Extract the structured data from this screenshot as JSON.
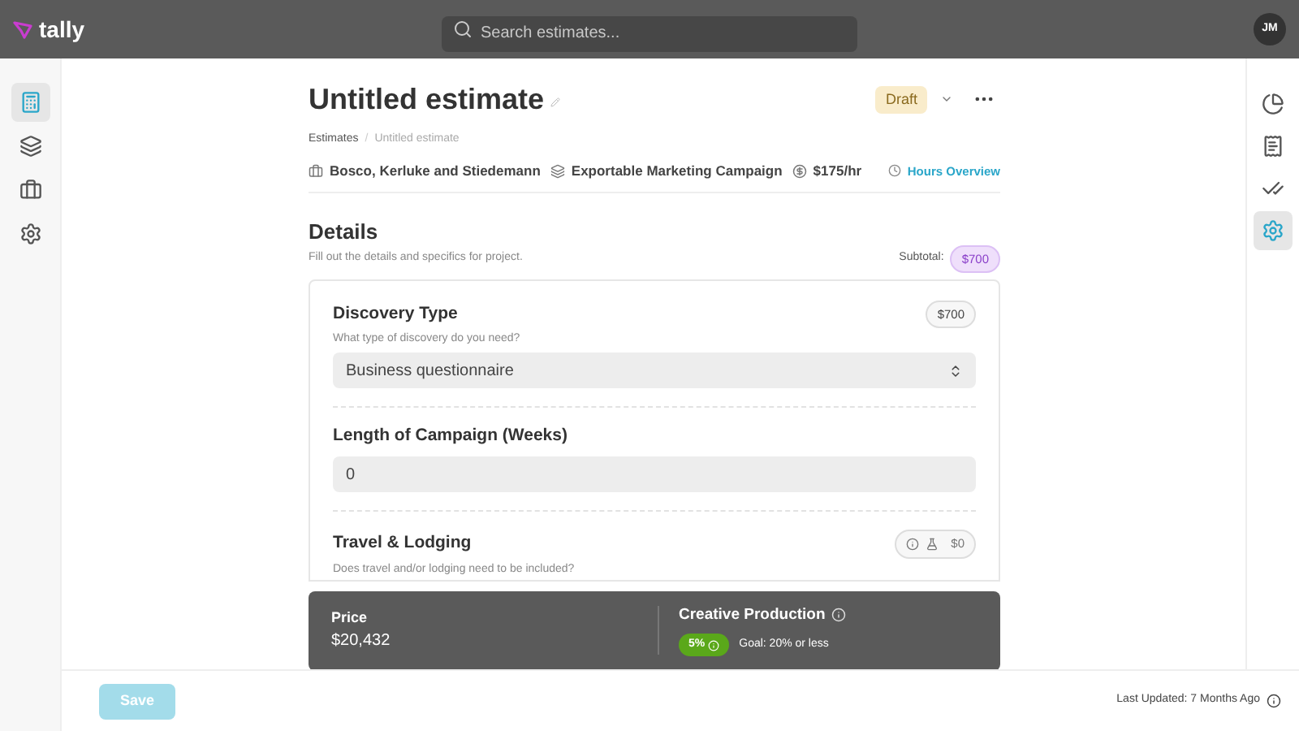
{
  "header": {
    "logo": "tally",
    "search": {
      "placeholder": "Search estimates..."
    },
    "avatar": "JM"
  },
  "left_nav": [
    {
      "selected": true
    },
    {
      "selected": false
    },
    {
      "selected": false
    },
    {
      "selected": false
    }
  ],
  "right_nav": [
    {
      "selected": false
    },
    {
      "selected": false
    },
    {
      "selected": false
    },
    {
      "selected": true
    }
  ],
  "title": "Untitled estimate",
  "status": "Draft",
  "breadcrumb": [
    "Estimates",
    "Untitled estimate"
  ],
  "breadcrumb_separator": "/",
  "meta": [
    "Bosco, Kerluke and Stiedemann",
    "Exportable Marketing Campaign",
    "$175/hr"
  ],
  "hours_link": "Hours Overview",
  "details": {
    "heading": "Details",
    "description": "Fill out the details and specifics for project.",
    "subtotal_label": "Subtotal:",
    "subtotal": "$700",
    "fields": [
      {
        "kind": "select",
        "label": "Discovery Type",
        "hint": "What type of discovery do you need?",
        "price": "$700",
        "value": "Business questionnaire"
      },
      {
        "kind": "input",
        "label": "Length of Campaign (Weeks)",
        "value": "0"
      },
      {
        "kind": "toggle",
        "label": "Travel & Lodging",
        "hint": "Does travel and/or lodging need to be included?",
        "price": "$0"
      }
    ]
  },
  "summary": {
    "price_label": "Price",
    "price": "$20,432",
    "category": "Creative Production",
    "percent": "5%",
    "goal": "Goal: 20% or less"
  },
  "footer": {
    "save": "Save",
    "save_disabled": true,
    "last_updated": "Last Updated: 7 Months Ago"
  }
}
